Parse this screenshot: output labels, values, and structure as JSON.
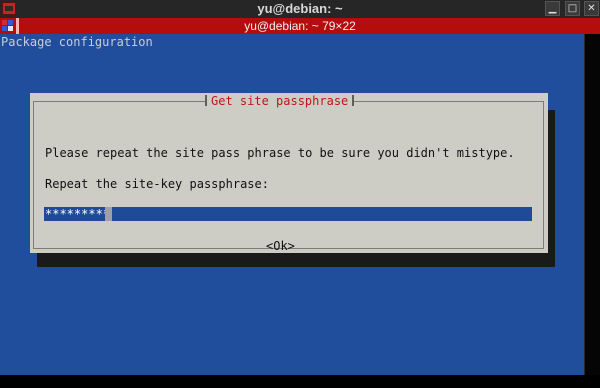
{
  "window": {
    "title": "yu@debian: ~",
    "menu_icon": "window-menu-icon",
    "controls": {
      "minimize": "▁",
      "maximize": "□",
      "close": "✕"
    }
  },
  "terminal": {
    "title": "yu@debian: ~ 79×22",
    "background_color": "#214e9c",
    "backtitle": "Package configuration"
  },
  "dialog": {
    "title": "Get site passphrase",
    "message": "Please repeat the site pass phrase to be sure you didn't mistype.",
    "field_label": "Repeat the site-key passphrase:",
    "field_value": "*********",
    "ok_label": "<Ok>",
    "title_color": "#c0141b",
    "background_color": "#cdcdc5"
  }
}
